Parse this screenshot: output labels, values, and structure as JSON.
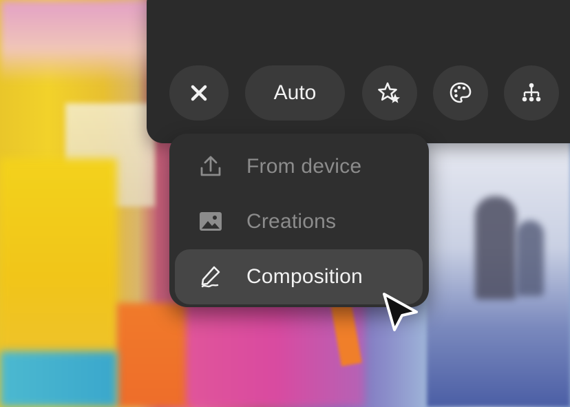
{
  "toolbar": {
    "close_icon": "close-icon",
    "mode_label": "Auto",
    "magic_icon": "sparkle-star-icon",
    "palette_icon": "palette-icon",
    "structure_icon": "hierarchy-icon"
  },
  "menu": {
    "items": [
      {
        "label": "From device",
        "icon": "upload-icon",
        "selected": false
      },
      {
        "label": "Creations",
        "icon": "image-icon",
        "selected": false
      },
      {
        "label": "Composition",
        "icon": "pen-icon",
        "selected": true
      }
    ]
  },
  "colors": {
    "panel": "#2b2b2b",
    "button": "#3a3a3a",
    "menu": "#2f2f2f",
    "selected": "#464646",
    "text": "#f2f2f2",
    "muted": "#8c8c8c"
  }
}
